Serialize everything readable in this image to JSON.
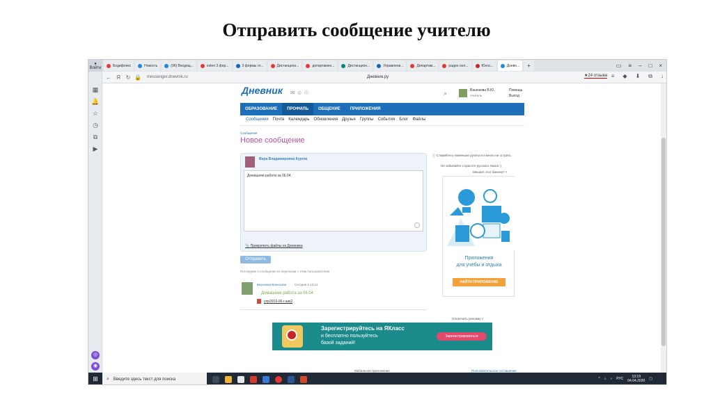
{
  "slide": {
    "title": "Отправить сообщение учителю"
  },
  "browser": {
    "profile_label": "Войти",
    "tabs": [
      {
        "label": "Бодифлекс",
        "color": "#e53935"
      },
      {
        "label": "Новость",
        "color": "#1e88e5"
      },
      {
        "label": "(96) Входящ...",
        "color": "#1e88e5"
      },
      {
        "label": "exten 3 фор...",
        "color": "#e53935"
      },
      {
        "label": "3 формы гл...",
        "color": "#1565c0"
      },
      {
        "label": "Дистанцион...",
        "color": "#e53935"
      },
      {
        "label": "департамен...",
        "color": "#e53935"
      },
      {
        "label": "Дистанцион...",
        "color": "#00897b"
      },
      {
        "label": "Управлени...",
        "color": "#1565c0"
      },
      {
        "label": "Департам...",
        "color": "#e53935"
      },
      {
        "label": "радио онл...",
        "color": "#e53935"
      },
      {
        "label": "Юнос...",
        "color": "#c62828"
      },
      {
        "label": "Дневн...",
        "color": "#1e88e5"
      }
    ],
    "url": "messenger.dnevnik.ru",
    "page_title": "Дневник.ру",
    "reviews": "★24 отзыва"
  },
  "site": {
    "logo": "Дневник",
    "user_name": "Ванюкова В.Ю.",
    "user_role": "Учитель",
    "help": "Помощь",
    "logout": "Выход",
    "main_nav": [
      {
        "label": "ОБРАЗОВАНИЕ",
        "active": false
      },
      {
        "label": "ПРОФИЛЬ",
        "active": true
      },
      {
        "label": "ОБЩЕНИЕ",
        "active": false
      },
      {
        "label": "ПРИЛОЖЕНИЯ",
        "active": false
      }
    ],
    "sub_nav": [
      "Сообщения",
      "Почта",
      "Календарь",
      "Обновления",
      "Друзья",
      "Группы",
      "События",
      "Блог",
      "Файлы"
    ],
    "breadcrumb": "Сообщения",
    "heading": "Новое сообщение",
    "compose": {
      "recipient": "Вера Владимировна Куртяк",
      "message": "Домашняя работа за 06.04.",
      "attach_link": "Прикрепить файлы из Дневника"
    },
    "send_button": "Отправить",
    "last_info": "Последние 3 сообщения из переписки с этим пользователем",
    "history": {
      "name": "Вероника Ванюкова",
      "time": "Сегодня в 13:14",
      "text": "Домашняя работа за 06.04",
      "file": "упр2019-06-г.ник2"
    },
    "tips": {
      "tip1": "Старайтесь поменьше ругаться и много не острить.",
      "tip2": "Не забывайте о красоте русского языка :)",
      "banner_question": "Мешает этот баннер? ×"
    },
    "ad_card": {
      "line1": "Приложения",
      "line2": "для учёбы и отдыха",
      "button": "НАЙТИ ПРИЛОЖЕНИЕ"
    },
    "ad_off": "Отключить рекламу ×",
    "banner": {
      "title": "Зарегистрируйтесь на ЯКласс",
      "sub1": "и бесплатно пользуйтесь",
      "sub2": "базой заданий!",
      "button": "Зарегистрироваться"
    },
    "footer": {
      "mobile": "Мобильное приложение",
      "terms": "Пользовательское соглашение"
    }
  },
  "taskbar": {
    "search_placeholder": "Введите здесь текст для поиска",
    "lang": "РУС",
    "time": "13:19",
    "date": "04.04.2020"
  }
}
